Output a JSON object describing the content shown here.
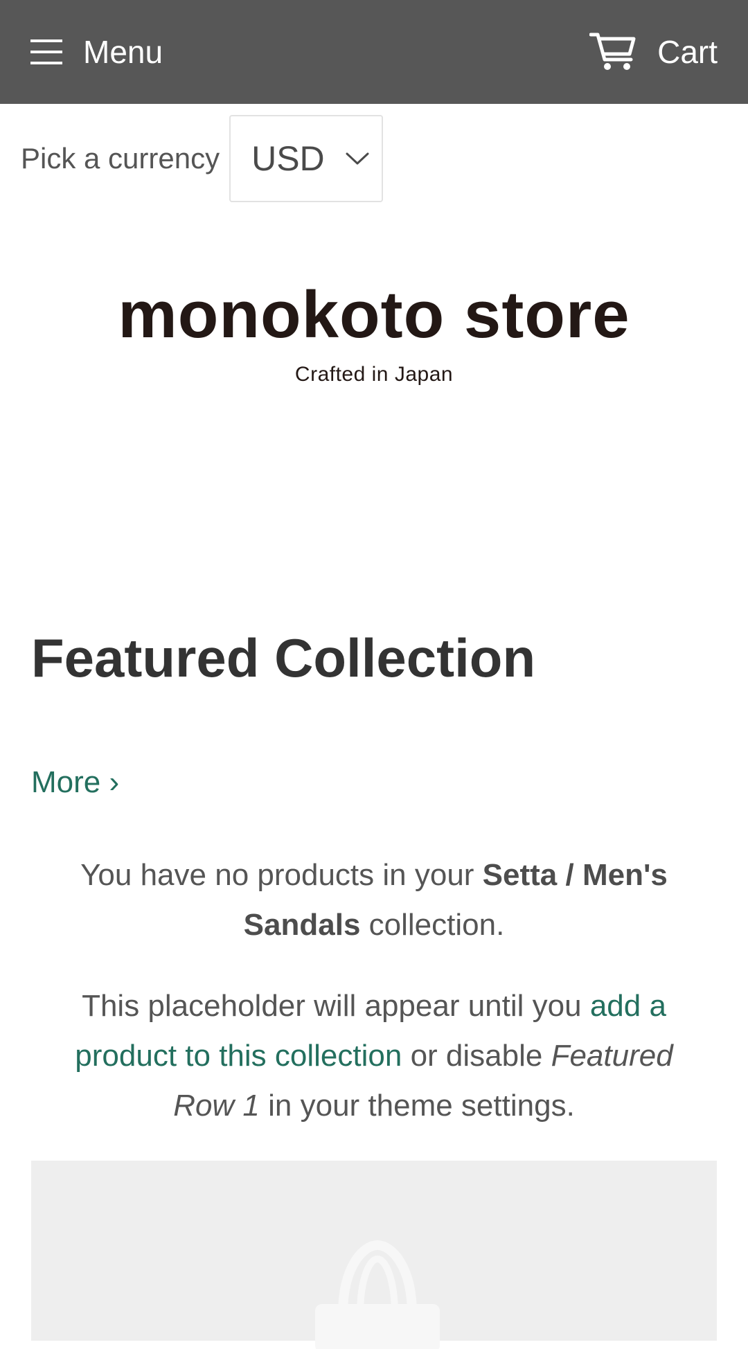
{
  "header": {
    "menu_label": "Menu",
    "cart_label": "Cart",
    "menu_icon": "hamburger-icon",
    "cart_icon": "shopping-cart-icon"
  },
  "currency": {
    "label": "Pick a currency",
    "selected": "USD",
    "dropdown_icon": "chevron-down-icon"
  },
  "logo": {
    "name": "monokoto store",
    "tagline": "Crafted in Japan"
  },
  "featured": {
    "title": "Featured Collection",
    "more_link": "More ›",
    "empty_text_prefix": "You have no products in your ",
    "collection_name": "Setta / Men's Sandals",
    "empty_text_suffix": " collection.",
    "placeholder_text_prefix": "This placeholder will appear until you ",
    "placeholder_link": "add a product to this collection",
    "placeholder_text_middle": " or disable ",
    "placeholder_setting": "Featured Row 1",
    "placeholder_text_suffix": " in your theme settings.",
    "placeholder_image_icon": "shopping-bag-icon"
  },
  "colors": {
    "header_bg": "#575757",
    "link": "#236f5e",
    "title": "#333333",
    "body_text": "#555555",
    "placeholder_bg": "#eeeeee"
  }
}
